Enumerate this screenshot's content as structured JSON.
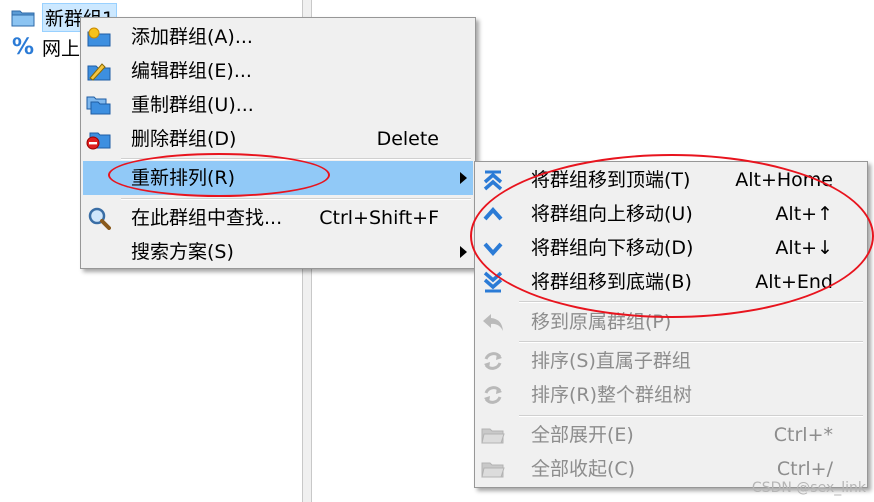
{
  "tree": {
    "items": [
      {
        "label": "新群组1",
        "icon": "folder-icon",
        "selected": true
      },
      {
        "label": "网上",
        "icon": "percent-icon",
        "selected": false
      }
    ]
  },
  "context_menu": {
    "items": [
      {
        "label": "添加群组(A)...",
        "shortcut": "",
        "icon": "folder-add-icon"
      },
      {
        "label": "编辑群组(E)...",
        "shortcut": "",
        "icon": "folder-edit-icon"
      },
      {
        "label": "重制群组(U)...",
        "shortcut": "",
        "icon": "folder-copy-icon"
      },
      {
        "label": "删除群组(D)",
        "shortcut": "Delete",
        "icon": "folder-delete-icon"
      },
      {
        "label": "重新排列(R)",
        "shortcut": "",
        "icon": "",
        "submenu": true,
        "highlighted": true
      },
      {
        "label": "在此群组中查找...",
        "shortcut": "Ctrl+Shift+F",
        "icon": "magnifier-icon"
      },
      {
        "label": "搜索方案(S)",
        "shortcut": "",
        "icon": "",
        "submenu": true
      }
    ]
  },
  "submenu": {
    "items": [
      {
        "label": "将群组移到顶端(T)",
        "shortcut": "Alt+Home",
        "icon": "move-top-icon",
        "disabled": false
      },
      {
        "label": "将群组向上移动(U)",
        "shortcut": "Alt+↑",
        "icon": "move-up-icon",
        "disabled": false
      },
      {
        "label": "将群组向下移动(D)",
        "shortcut": "Alt+↓",
        "icon": "move-down-icon",
        "disabled": false
      },
      {
        "label": "将群组移到底端(B)",
        "shortcut": "Alt+End",
        "icon": "move-bottom-icon",
        "disabled": false
      },
      {
        "label": "移到原属群组(P)",
        "shortcut": "",
        "icon": "undo-arrow-icon",
        "disabled": true
      },
      {
        "label": "排序(S)直属子群组",
        "shortcut": "",
        "icon": "sort-icon",
        "disabled": true
      },
      {
        "label": "排序(R)整个群组树",
        "shortcut": "",
        "icon": "sort-icon",
        "disabled": true
      },
      {
        "label": "全部展开(E)",
        "shortcut": "Ctrl+*",
        "icon": "folder-open-icon",
        "disabled": true
      },
      {
        "label": "全部收起(C)",
        "shortcut": "Ctrl+/",
        "icon": "folder-open-icon",
        "disabled": true
      }
    ]
  },
  "watermark": "CSDN @sex_link",
  "colors": {
    "highlight": "#91c9f7",
    "annotation": "#e8141e",
    "icon_blue": "#2b7bd6"
  }
}
